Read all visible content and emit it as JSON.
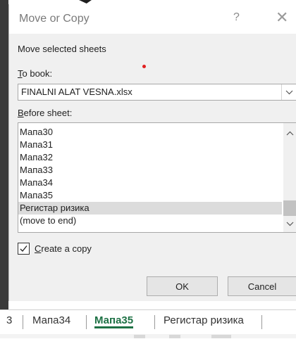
{
  "dialog": {
    "title": "Move or Copy",
    "help_icon": "question-mark-icon",
    "close_icon": "close-icon",
    "help_glyph": "?",
    "close_glyph": "✕",
    "move_selected_label": "Move selected sheets",
    "to_book_label_first": "T",
    "to_book_label_rest": "o book:",
    "to_book_value": "FINALNI ALAT VESNA.xlsx",
    "before_sheet_label_first": "B",
    "before_sheet_label_rest": "efore sheet:",
    "sheets": [
      "Мапа30",
      "Мапа31",
      "Мапа32",
      "Мапа33",
      "Мапа34",
      "Мапа35",
      "Регистар ризика",
      "(move to end)"
    ],
    "selected_sheet_index": 6,
    "create_copy_first": "C",
    "create_copy_rest": "reate a copy",
    "create_copy_checked": true,
    "ok_label": "OK",
    "cancel_label": "Cancel"
  },
  "sheet_tabs": {
    "partial": "3",
    "items": [
      "Мапа34",
      "Мапа35",
      "Регистар ризика"
    ],
    "active_index": 1
  },
  "colors": {
    "accent_green": "#1e7145",
    "selection_bg": "#dcdcdc",
    "red_dot": "#e02020"
  }
}
